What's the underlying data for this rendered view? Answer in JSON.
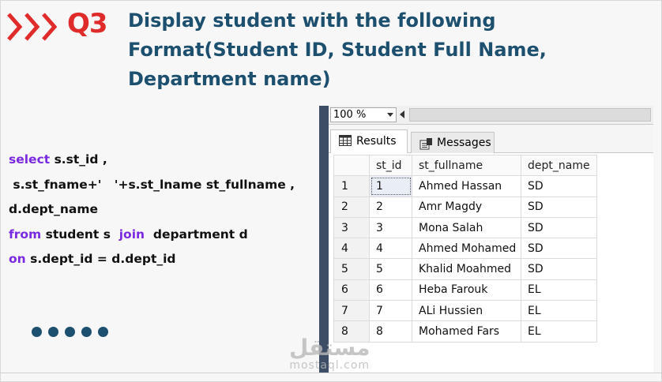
{
  "header": {
    "question": "Q3",
    "title_lines": [
      "Display student with the following",
      "Format(Student ID, Student Full Name,",
      "Department name)"
    ]
  },
  "code": {
    "lines": [
      [
        {
          "t": "select ",
          "kw": true
        },
        {
          "t": "s.st_id ,",
          "kw": false
        }
      ],
      [
        {
          "t": " s.st_fname+'   '+s.st_lname st_fullname ,",
          "kw": false
        }
      ],
      [
        {
          "t": "d.dept_name",
          "kw": false
        }
      ],
      [
        {
          "t": "from ",
          "kw": true
        },
        {
          "t": "student s  ",
          "kw": false
        },
        {
          "t": "join ",
          "kw": true
        },
        {
          "t": " department d",
          "kw": false
        }
      ],
      [
        {
          "t": "on ",
          "kw": true
        },
        {
          "t": "s.dept_id = d.dept_id",
          "kw": false
        }
      ]
    ]
  },
  "ssms": {
    "zoom": "100 %",
    "tabs": {
      "results": "Results",
      "messages": "Messages"
    },
    "columns": [
      "",
      "st_id",
      "st_fullname",
      "dept_name"
    ],
    "rows": [
      [
        "1",
        "1",
        "Ahmed Hassan",
        "SD"
      ],
      [
        "2",
        "2",
        "Amr Magdy",
        "SD"
      ],
      [
        "3",
        "3",
        "Mona Salah",
        "SD"
      ],
      [
        "4",
        "4",
        "Ahmed Mohamed",
        "SD"
      ],
      [
        "5",
        "5",
        "Khalid Moahmed",
        "SD"
      ],
      [
        "6",
        "6",
        "Heba Farouk",
        "EL"
      ],
      [
        "7",
        "7",
        "ALi Hussien",
        "EL"
      ],
      [
        "8",
        "8",
        "Mohamed Fars",
        "EL"
      ]
    ]
  },
  "watermark": {
    "arabic": "مستقل",
    "latin": "mostaql.com"
  },
  "colors": {
    "accent_red": "#e02b2b",
    "title_blue": "#1d4f6e",
    "keyword_purple": "#7a2ae0"
  },
  "icons": [
    "triple-chevron-icon",
    "grid-icon",
    "messages-icon",
    "dropdown-arrow-icon",
    "scroll-left-arrow-icon"
  ]
}
